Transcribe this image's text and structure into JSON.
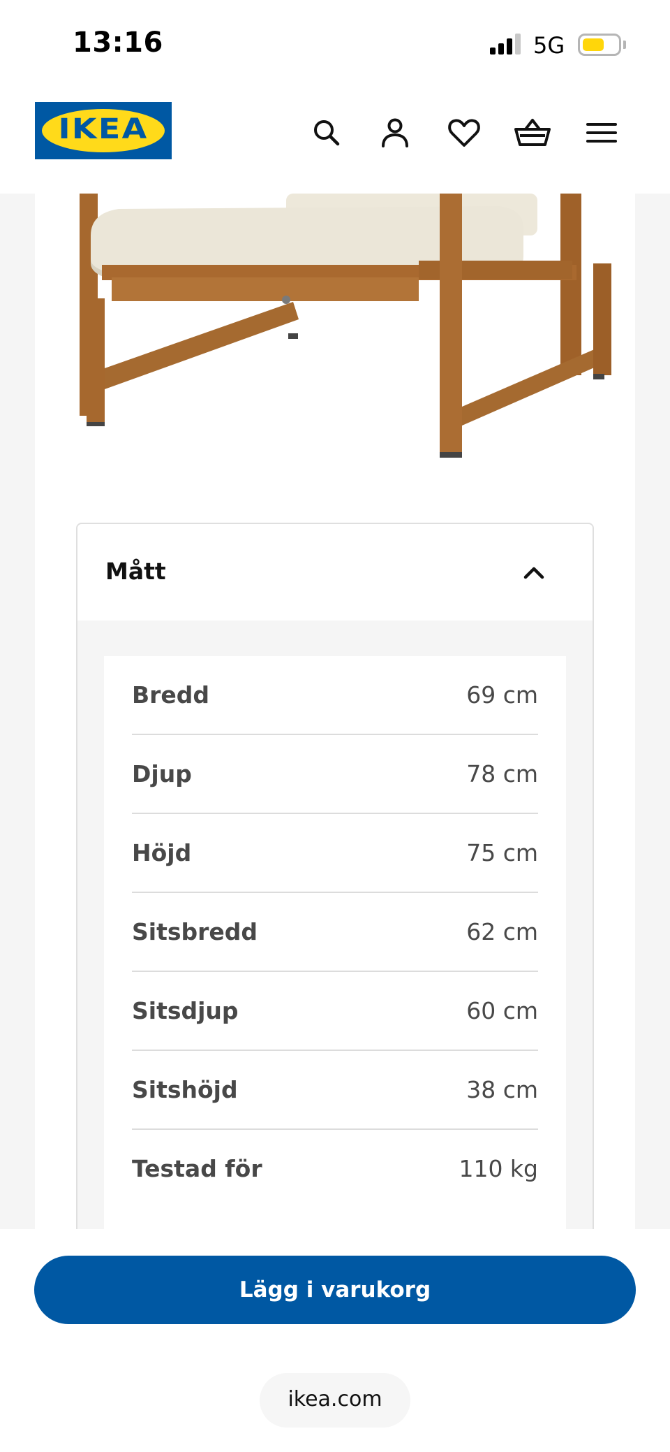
{
  "status_bar": {
    "time": "13:16",
    "network": "5G",
    "signal_bars_active": 3,
    "battery_color": "#ffd60a"
  },
  "header": {
    "logo_text": "IKEA",
    "brand_blue": "#0058a3",
    "brand_yellow": "#ffda1a",
    "icons": [
      "search-icon",
      "account-icon",
      "heart-icon",
      "basket-icon",
      "menu-icon"
    ]
  },
  "product_image": {
    "description_icon": "outdoor-armchair-image"
  },
  "dimensions": {
    "title": "Mått",
    "expanded": true,
    "rows": [
      {
        "label": "Bredd",
        "value": "69 cm"
      },
      {
        "label": "Djup",
        "value": "78 cm"
      },
      {
        "label": "Höjd",
        "value": "75 cm"
      },
      {
        "label": "Sitsbredd",
        "value": "62 cm"
      },
      {
        "label": "Sitsdjup",
        "value": "60 cm"
      },
      {
        "label": "Sitshöjd",
        "value": "38 cm"
      },
      {
        "label": "Testad för",
        "value": "110 kg"
      }
    ]
  },
  "footer": {
    "add_to_cart_label": "Lägg i varukorg",
    "url": "ikea.com"
  }
}
